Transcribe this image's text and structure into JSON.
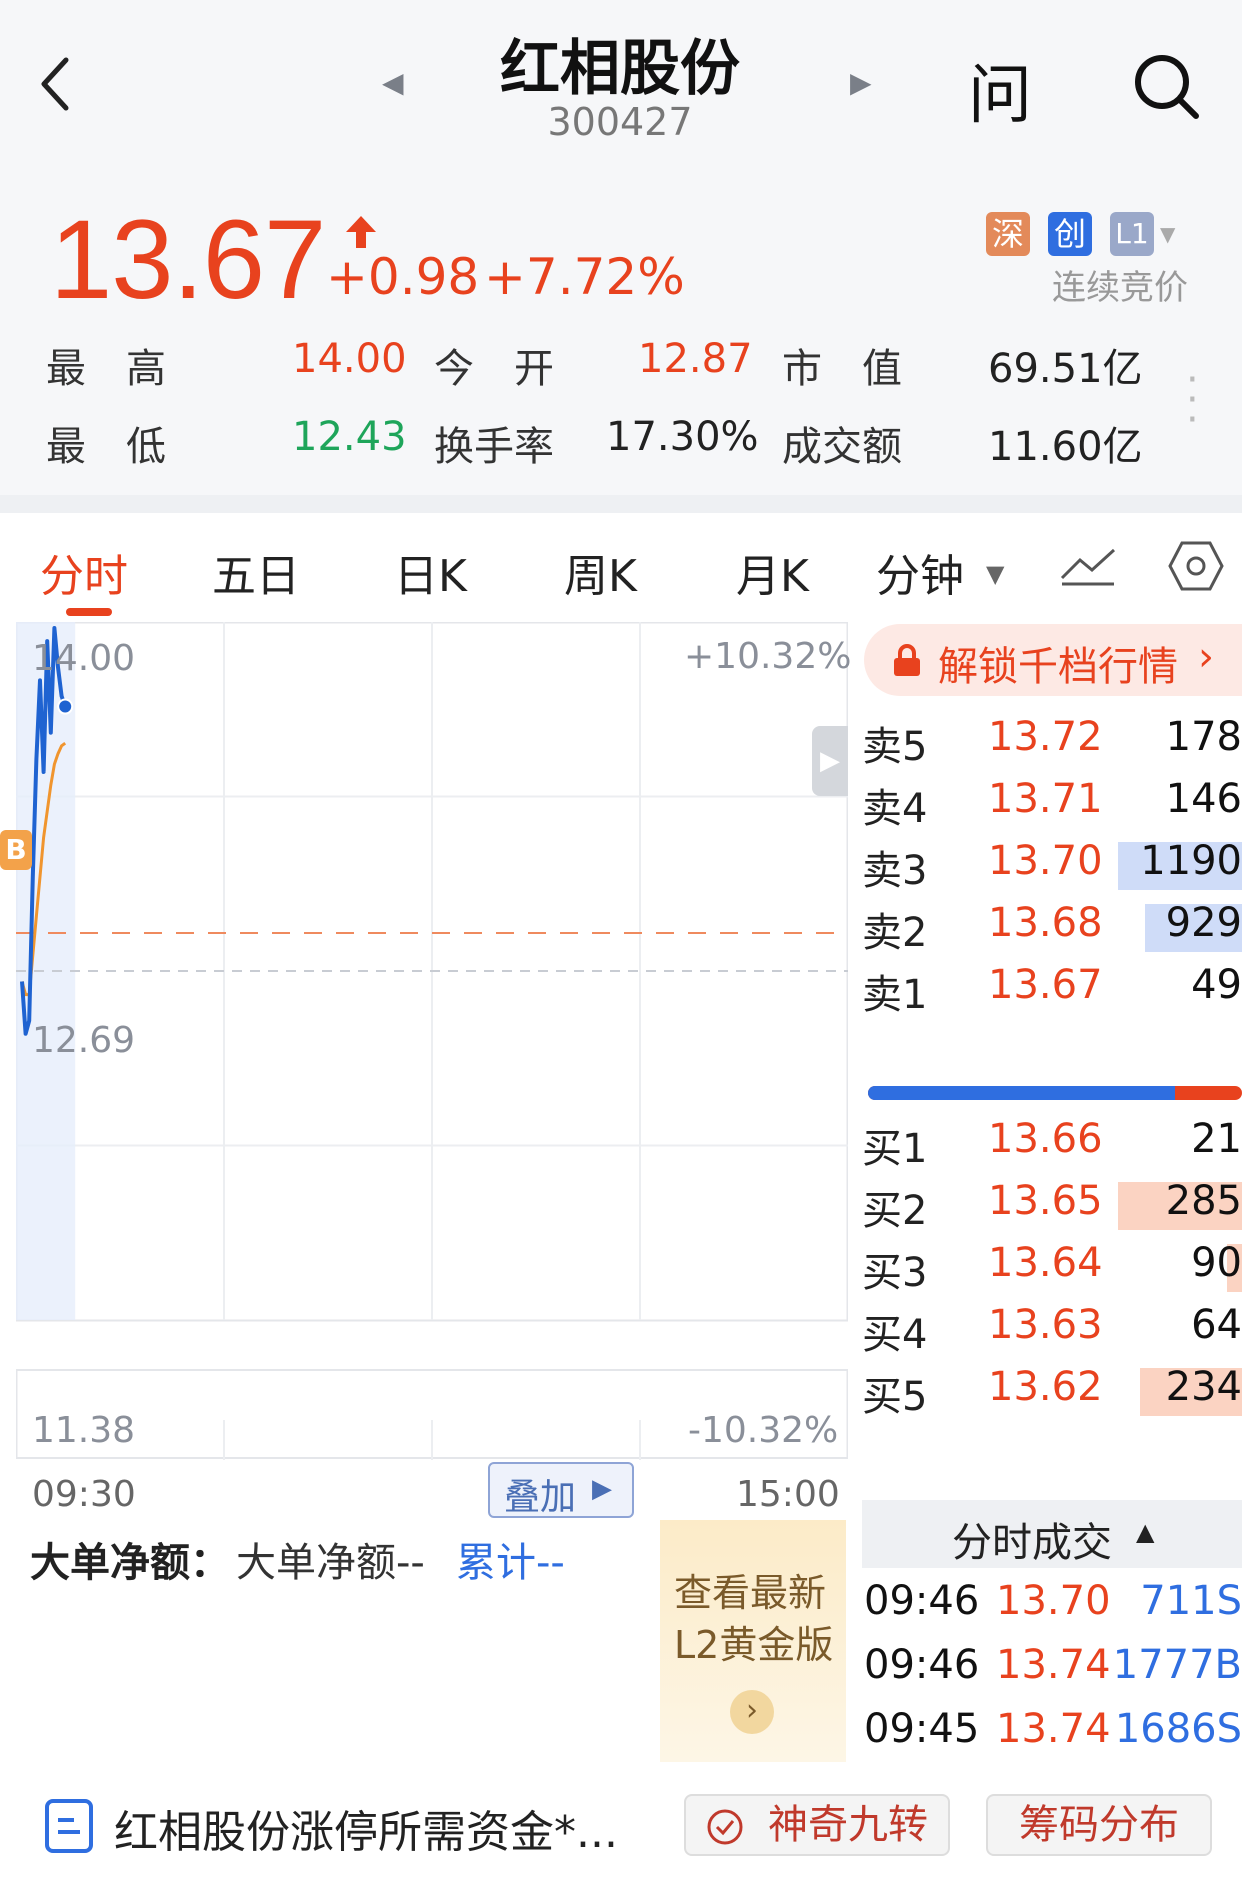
{
  "header": {
    "title": "红相股份",
    "code": "300427",
    "ask_label": "问"
  },
  "quote": {
    "price": "13.67",
    "change": "+0.98",
    "change_pct": "+7.72%",
    "badge_sz": "深",
    "badge_cy": "创",
    "badge_l1": "L1",
    "auction_label": "连续竞价",
    "stats": {
      "high_label": "最　高",
      "high": "14.00",
      "open_label": "今　开",
      "open": "12.87",
      "mcap_label": "市　值",
      "mcap": "69.51亿",
      "low_label": "最　低",
      "low": "12.43",
      "turnover_label": "换手率",
      "turnover": "17.30%",
      "amount_label": "成交额",
      "amount": "11.60亿"
    }
  },
  "tabs": [
    "分时",
    "五日",
    "日K",
    "周K",
    "月K",
    "分钟"
  ],
  "chart": {
    "y_top": "14.00",
    "y_mid": "12.69",
    "y_bot": "11.38",
    "pct_top": "+10.32%",
    "pct_bot": "-10.32%",
    "t_start": "09:30",
    "t_end": "15:00",
    "overlay_label": "叠加",
    "marker_b": "B",
    "colors": {
      "price_line": "#1f63d1",
      "avg_line": "#f0952e",
      "prev_close": "#ef8a5e"
    }
  },
  "chart_data": {
    "type": "line",
    "ylim": [
      11.38,
      14.0
    ],
    "prev_close": 12.69,
    "series": [
      {
        "values": [
          12.65,
          12.45,
          12.5,
          13.05,
          13.5,
          13.8,
          13.45,
          13.95,
          13.6,
          14.0,
          13.85,
          13.74,
          13.7
        ]
      },
      {
        "values": [
          12.65,
          12.6,
          12.6,
          12.75,
          12.9,
          13.05,
          13.2,
          13.3,
          13.4,
          13.48,
          13.52,
          13.55,
          13.56
        ]
      }
    ]
  },
  "big_order": {
    "label": "大单净额：",
    "value": "大单净额--",
    "cum": "累计--",
    "promo_line1": "查看最新",
    "promo_line2": "L2黄金版"
  },
  "orderbook": {
    "unlock_label": "解锁千档行情",
    "asks": [
      {
        "side": "卖5",
        "price": "13.72",
        "vol": "178",
        "fill": 0.0
      },
      {
        "side": "卖4",
        "price": "13.71",
        "vol": "146",
        "fill": 0.0
      },
      {
        "side": "卖3",
        "price": "13.70",
        "vol": "1190",
        "fill": 1.0
      },
      {
        "side": "卖2",
        "price": "13.68",
        "vol": "929",
        "fill": 0.78
      },
      {
        "side": "卖1",
        "price": "13.67",
        "vol": "49",
        "fill": 0.0
      }
    ],
    "bids": [
      {
        "side": "买1",
        "price": "13.66",
        "vol": "21",
        "fill": 0.0
      },
      {
        "side": "买2",
        "price": "13.65",
        "vol": "285",
        "fill": 1.0
      },
      {
        "side": "买3",
        "price": "13.64",
        "vol": "90",
        "fill": 0.12
      },
      {
        "side": "买4",
        "price": "13.63",
        "vol": "64",
        "fill": 0.0
      },
      {
        "side": "买5",
        "price": "13.62",
        "vol": "234",
        "fill": 0.82
      }
    ],
    "buy_sell_ratio": 0.82
  },
  "trades": {
    "title": "分时成交",
    "rows": [
      {
        "time": "09:46",
        "price": "13.70",
        "vol": "711S"
      },
      {
        "time": "09:46",
        "price": "13.74",
        "vol": "1777B"
      },
      {
        "time": "09:45",
        "price": "13.74",
        "vol": "1686S"
      }
    ]
  },
  "bottom": {
    "news": "红相股份涨停所需资金*...",
    "btn1": "神奇九转",
    "btn2": "筹码分布"
  }
}
